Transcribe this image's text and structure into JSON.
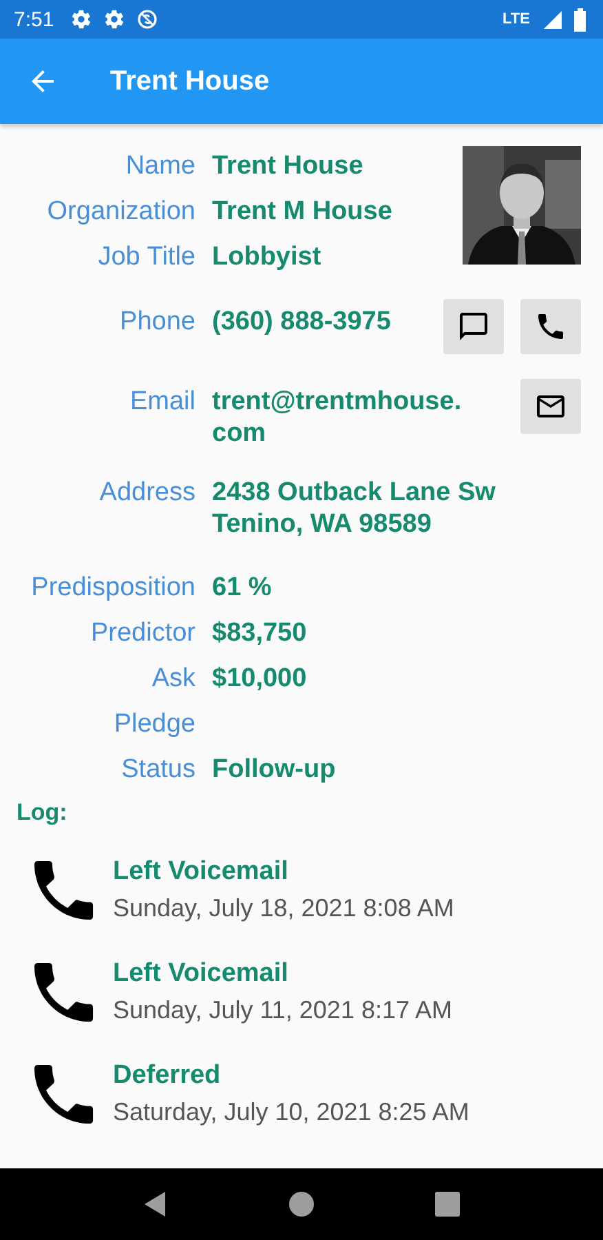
{
  "status_bar": {
    "time": "7:51",
    "network": "LTE"
  },
  "app_bar": {
    "title": "Trent House"
  },
  "contact": [
    {
      "label": "Name",
      "value": "Trent House"
    },
    {
      "label": "Organization",
      "value": "Trent M House"
    },
    {
      "label": "Job Title",
      "value": "Lobbyist"
    },
    {
      "label": "Phone",
      "value": "(360) 888-3975",
      "actions": [
        {
          "kind": "message"
        },
        {
          "kind": "call"
        }
      ]
    },
    {
      "label": "Email",
      "value": "trent@trentmhouse.com",
      "actions": [
        {
          "kind": "email"
        }
      ]
    },
    {
      "label": "Address",
      "value": "2438 Outback Lane Sw Tenino, WA 98589"
    }
  ],
  "details": [
    {
      "label": "Predisposition",
      "value": "61 %"
    },
    {
      "label": "Predictor",
      "value": "$83,750"
    },
    {
      "label": "Ask",
      "value": "$10,000"
    },
    {
      "label": "Pledge"
    },
    {
      "label": "Status",
      "value": "Follow-up"
    }
  ],
  "log": {
    "title": "Log:",
    "entries": [
      {
        "kind": "call",
        "title": "Left Voicemail",
        "date": "Sunday, July 18, 2021 8:08 AM"
      },
      {
        "kind": "call",
        "title": "Left Voicemail",
        "date": "Sunday, July 11, 2021 8:17 AM"
      },
      {
        "kind": "call",
        "title": "Deferred",
        "date": "Saturday, July 10, 2021 8:25 AM"
      }
    ]
  }
}
